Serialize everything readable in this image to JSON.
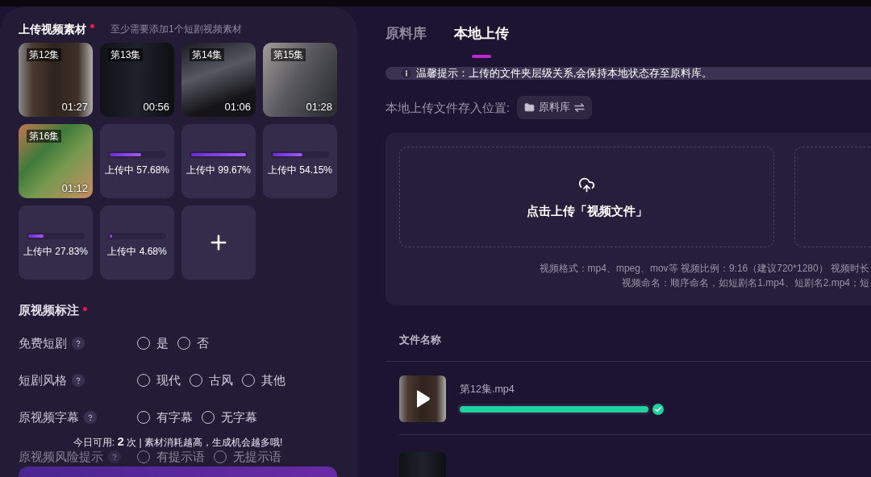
{
  "upload_section": {
    "title": "上传视频素材",
    "required": true,
    "hint": "至少需要添加1个短剧视频素材"
  },
  "videos": [
    {
      "kind": "video",
      "label": "第12集",
      "duration": "01:27"
    },
    {
      "kind": "video",
      "label": "第13集",
      "duration": "00:56"
    },
    {
      "kind": "video",
      "label": "第14集",
      "duration": "01:06"
    },
    {
      "kind": "video",
      "label": "第15集",
      "duration": "01:28"
    },
    {
      "kind": "video",
      "label": "第16集",
      "duration": "01:12"
    },
    {
      "kind": "uploading",
      "status": "上传中 57.68%",
      "level": 0.5768
    },
    {
      "kind": "uploading",
      "status": "上传中 99.67%",
      "level": 0.9967
    },
    {
      "kind": "uploading",
      "status": "上传中 54.15%",
      "level": 0.5415
    },
    {
      "kind": "uploading",
      "status": "上传中 27.83%",
      "level": 0.2783
    },
    {
      "kind": "uploading",
      "status": "上传中 4.68%",
      "level": 0.0468
    },
    {
      "kind": "add"
    }
  ],
  "annotation": {
    "title": "原视频标注",
    "required": true,
    "rows": [
      {
        "label": "免费短剧",
        "dimmed": false,
        "options": [
          {
            "label": "是",
            "selected": false
          },
          {
            "label": "否",
            "selected": false
          }
        ]
      },
      {
        "label": "短剧风格",
        "dimmed": false,
        "options": [
          {
            "label": "现代",
            "selected": false
          },
          {
            "label": "古风",
            "selected": false
          },
          {
            "label": "其他",
            "selected": false
          }
        ]
      },
      {
        "label": "原视频字幕",
        "dimmed": false,
        "options": [
          {
            "label": "有字幕",
            "selected": false
          },
          {
            "label": "无字幕",
            "selected": false
          }
        ]
      },
      {
        "label": "原视频风险提示",
        "dimmed": true,
        "options": [
          {
            "label": "有提示语",
            "selected": false
          },
          {
            "label": "无提示语",
            "selected": false
          }
        ]
      }
    ]
  },
  "footer": {
    "quota": "今日可用: **2** 次 | 素材消耗越高，生成机会越多哦!"
  },
  "tabs": [
    {
      "label": "原料库",
      "selected": false
    },
    {
      "label": "本地上传",
      "selected": true
    }
  ],
  "notice": "温馨提示：上传的文件夹层级关系,会保持本地状态存至原料库。",
  "save_location": {
    "label": "本地上传文件存入位置:",
    "folder": "原料库"
  },
  "upload_zones": [
    {
      "kind": "upload",
      "label": "点击上传「视频文件」"
    },
    {
      "kind": "partial"
    }
  ],
  "format_hints": [
    "视频格式：mp4、mpeg、mov等 视频比例：9:16（建议720*1280） 视频时长",
    "视频命名：顺序命名，如短剧名1.mp4、短剧名2.mp4；短"
  ],
  "file_table": {
    "columns": [
      "文件名称"
    ],
    "rows": [
      {
        "kind": "file",
        "name": "第12集.mp4",
        "level": 1,
        "done": true
      },
      {
        "kind": "partial"
      }
    ]
  }
}
